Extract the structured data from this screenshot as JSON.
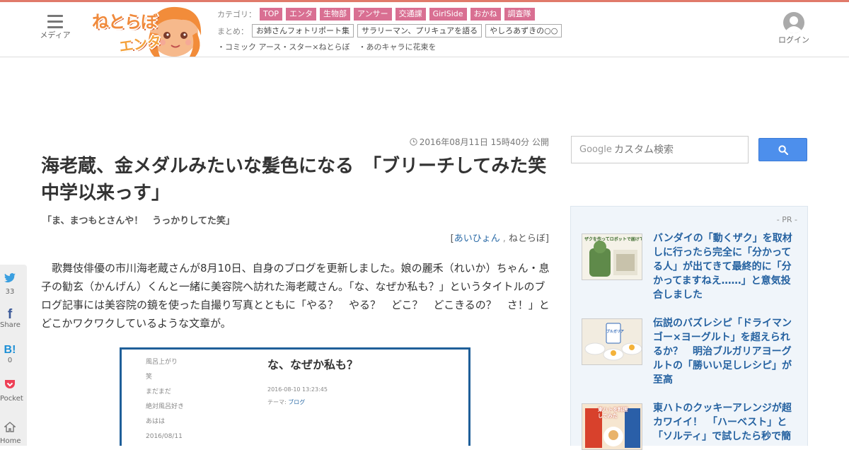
{
  "header": {
    "menu_label": "メディア",
    "logo_line1": "ねとらぼ",
    "logo_line2": "エンタ",
    "category_key": "カテゴリ：",
    "categories": [
      "TOP",
      "エンタ",
      "生物部",
      "アンサー",
      "交通課",
      "GirlSide",
      "おかね",
      "調査隊"
    ],
    "matome_key": "まとめ：",
    "matome": [
      "お姉さんフォトリポート集",
      "サラリーマン、プリキュアを語る",
      "やしろあずきの○○"
    ],
    "extra_links": [
      "・コミック アース・スター×ねとらぼ",
      "・あのキャラに花束を"
    ],
    "login_label": "ログイン",
    "accent_color": "#d96f92"
  },
  "article": {
    "date": "2016年08月11日 15時40分 公開",
    "title": "海老蔵、金メダルみたいな髪色になる　「ブリーチしてみた笑　中学以来っす」",
    "subtitle": "「ま、まつもとさんや！　うっかりしてた笑」",
    "author_open": "[",
    "author_name": "あいひょん",
    "author_sep": ",",
    "author_site": "ねとらぼ",
    "author_close": "]",
    "body": "歌舞伎俳優の市川海老蔵さんが8月10日、自身のブログを更新しました。娘の麗禾（れいか）ちゃん・息子の勧玄（かんげん）くんと一緒に美容院へ訪れた海老蔵さん。「な、なぜか私も？」というタイトルのブログ記事には美容院の鏡を使った自撮り写真とともに「やる？　やる？　どこ？　どこきるの？　さ！」とどこかワクワクしているような文章が。",
    "screenshot": {
      "side_items": [
        "風呂上がり",
        "笑",
        "まだまだ",
        "絶対風呂好き",
        "あはは",
        "2016/08/11"
      ],
      "post_title": "な、なぜか私も？",
      "post_date": "2016-08-10 13:23:45",
      "theme_key": "テーマ:",
      "theme_value": "ブログ"
    }
  },
  "share": {
    "twitter_count": "33",
    "facebook_label": "Share",
    "hatena_count": "0",
    "pocket_label": "Pocket",
    "home_label": "Home"
  },
  "sidebar": {
    "search_brand": "Google",
    "search_placeholder": "カスタム検索",
    "search_button_color": "#4d8fec",
    "pr_label": "- PR -",
    "pr_items": [
      "バンダイの「動くザク」を取材しに行ったら完全に「分かってる人」が出てきて最終的に「分かってますねえ……」と意気投合しました",
      "伝説のバズレシピ「ドライマンゴー×ヨーグルト」を超えられるか？　明治ブルガリアヨーグルトの「勝いい足しレシピ」が至高",
      "東ハトのクッキーアレンジが超カワイイ！　「ハーベスト」と「ソルティ」で試したら秒で簡"
    ],
    "pr_thumb_labels": [
      "ザクを作ってロボットで届けてみた",
      "ブルガリア",
      "東ハトを料理してみた"
    ]
  }
}
